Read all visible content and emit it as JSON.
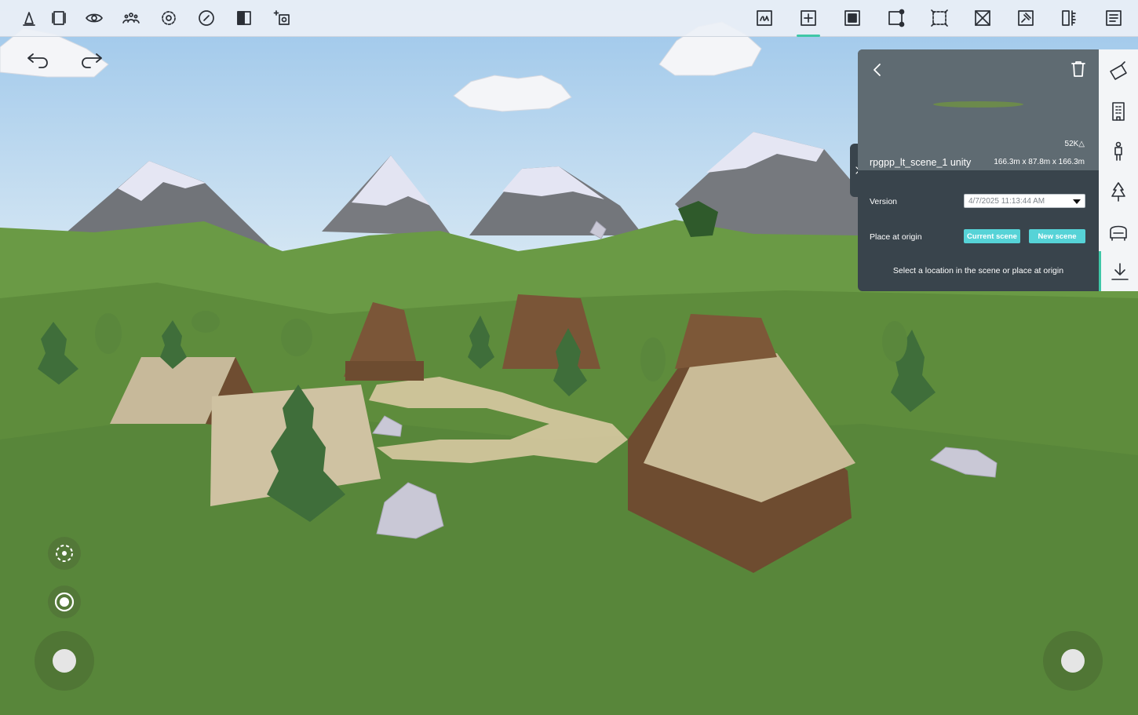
{
  "toolbar_left": [
    {
      "name": "paint-icon",
      "label": ""
    },
    {
      "name": "frame-icon",
      "label": ""
    },
    {
      "name": "eye-icon",
      "label": ""
    },
    {
      "name": "people-icon",
      "label": ""
    },
    {
      "name": "settings-icon",
      "label": ""
    },
    {
      "name": "compass-icon",
      "label": ""
    },
    {
      "name": "split-view-icon",
      "label": ""
    },
    {
      "name": "ai-camera-icon",
      "label": ""
    }
  ],
  "toolbar_right": [
    {
      "name": "draw-icon"
    },
    {
      "name": "add-object-icon",
      "active": true
    },
    {
      "name": "solid-square-icon"
    },
    {
      "name": "node-square-icon"
    },
    {
      "name": "dashed-square-icon"
    },
    {
      "name": "cross-square-icon"
    },
    {
      "name": "pin-square-icon"
    },
    {
      "name": "ruler-icon"
    },
    {
      "name": "list-icon"
    }
  ],
  "colors": {
    "accent": "#3fc7a7",
    "button": "#56d3d7",
    "panel": "#39444c",
    "preview": "#5f6b72"
  },
  "panel": {
    "triangle_count": "52K△",
    "asset_name": "rpgpp_lt_scene_1 unity",
    "dimensions": "166.3m x 87.8m x 166.3m",
    "version_label": "Version",
    "version_value": "4/7/2025 11:13:44 AM",
    "place_label": "Place at origin",
    "current_scene_button": "Current scene",
    "new_scene_button": "New scene",
    "hint": "Select a location in the scene or place at origin"
  },
  "rail": [
    {
      "name": "shapes-icon"
    },
    {
      "name": "building-icon"
    },
    {
      "name": "figure-icon"
    },
    {
      "name": "tree-icon"
    },
    {
      "name": "furniture-icon"
    },
    {
      "name": "download-icon",
      "active": true
    }
  ]
}
